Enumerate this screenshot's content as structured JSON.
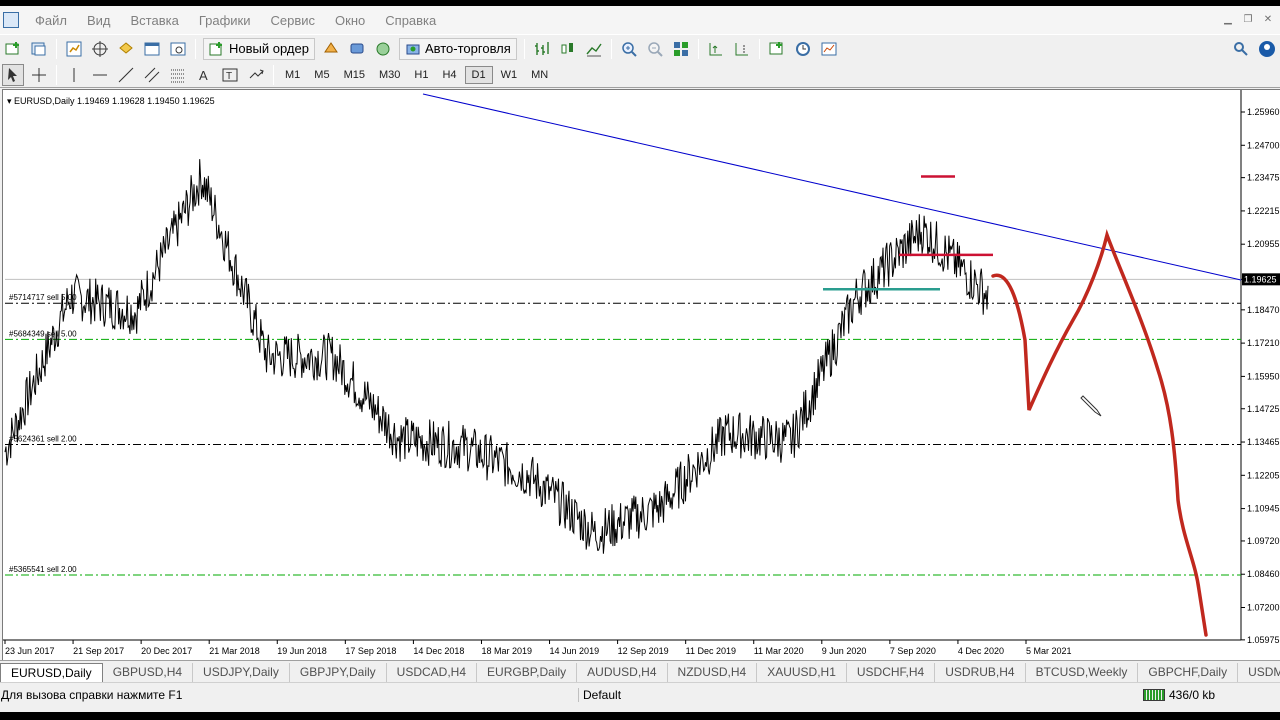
{
  "menu": [
    "Файл",
    "Вид",
    "Вставка",
    "Графики",
    "Сервис",
    "Окно",
    "Справка"
  ],
  "toolbar": {
    "new_order": "Новый ордер",
    "autotrading": "Авто-торговля",
    "icons": [
      "new-chart-icon",
      "profiles-icon",
      "market-watch-icon",
      "navigator-icon",
      "data-window-icon",
      "terminal-icon",
      "tester-icon",
      "metaeditor-icon",
      "signals-icon",
      "bar-chart-icon",
      "candles-icon",
      "line-chart-icon",
      "zoom-in-icon",
      "zoom-out-icon",
      "tile-windows-icon",
      "autoscroll-icon",
      "chart-shift-icon",
      "indicators-icon",
      "periods-icon",
      "templates-icon",
      "search-icon"
    ]
  },
  "draw_tools": [
    "cursor-icon",
    "crosshair-icon",
    "vertical-line-icon",
    "horizontal-line-icon",
    "trendline-icon",
    "equidistant-channel-icon",
    "fibonacci-icon",
    "text-icon",
    "text-label-icon",
    "arrows-icon"
  ],
  "timeframes": [
    "M1",
    "M5",
    "M15",
    "M30",
    "H1",
    "H4",
    "D1",
    "W1",
    "MN"
  ],
  "active_timeframe": "D1",
  "chart": {
    "header": "EURUSD,Daily  1.19469 1.19628 1.19450 1.19625",
    "current_price": "1.19625",
    "orders": [
      {
        "text": "#5714717 sell 5.00",
        "price": 1.1872
      },
      {
        "text": "#5684349 sell 5.00",
        "price": 1.1735
      },
      {
        "text": "#5624361 sell 2.00",
        "price": 1.1337
      },
      {
        "text": "#5365541 sell 2.00",
        "price": 1.0843
      }
    ],
    "colors": {
      "bear_order_line": "#000000",
      "bull_order_line": "#00aa00",
      "trendline": "#0000cc",
      "levels": "#cc1133",
      "support": "#2a9d8f",
      "drawing": "#c0281e"
    }
  },
  "chart_data": {
    "type": "line",
    "title": "EURUSD,Daily",
    "symbol": "EURUSD",
    "timeframe": "Daily",
    "ohlc_last": {
      "open": 1.19469,
      "high": 1.19628,
      "low": 1.1945,
      "close": 1.19625
    },
    "y_ticks": [
      "1.25960",
      "1.24700",
      "1.23475",
      "1.22215",
      "1.20955",
      "1.19625",
      "1.18470",
      "1.17210",
      "1.15950",
      "1.14725",
      "1.13465",
      "1.12205",
      "1.10945",
      "1.09720",
      "1.08460",
      "1.07200",
      "1.05975"
    ],
    "x_ticks": [
      "23 Jun 2017",
      "21 Sep 2017",
      "20 Dec 2017",
      "21 Mar 2018",
      "19 Jun 2018",
      "17 Sep 2018",
      "14 Dec 2018",
      "18 Mar 2019",
      "14 Jun 2019",
      "12 Sep 2019",
      "11 Dec 2019",
      "11 Mar 2020",
      "9 Jun 2020",
      "7 Sep 2020",
      "4 Dec 2020",
      "5 Mar 2021"
    ],
    "ylim": [
      1.0597,
      1.2596
    ],
    "series": [
      {
        "x": [
          "23 Jun 2017",
          "21 Sep 2017",
          "20 Dec 2017",
          "21 Mar 2018",
          "19 Jun 2018",
          "17 Sep 2018",
          "14 Dec 2018",
          "18 Mar 2019",
          "14 Jun 2019",
          "12 Sep 2019",
          "11 Dec 2019",
          "11 Mar 2020",
          "9 Jun 2020",
          "7 Sep 2020",
          "4 Dec 2020",
          "5 Mar 2021"
        ],
        "values": [
          1.131,
          1.19,
          1.184,
          1.235,
          1.167,
          1.167,
          1.136,
          1.133,
          1.122,
          1.1,
          1.11,
          1.138,
          1.135,
          1.19,
          1.215,
          1.19
        ]
      }
    ],
    "grid": false
  },
  "tabs": [
    "EURUSD,Daily",
    "GBPUSD,H4",
    "USDJPY,Daily",
    "GBPJPY,Daily",
    "USDCAD,H4",
    "EURGBP,Daily",
    "AUDUSD,H4",
    "NZDUSD,H4",
    "XAUUSD,H1",
    "USDCHF,H4",
    "USDRUB,H4",
    "BTCUSD,Weekly",
    "GBPCHF,Daily",
    "USDMXN,H"
  ],
  "status": {
    "help": "Для вызова справки нажмите F1",
    "profile": "Default",
    "traffic": "436/0 kb"
  }
}
